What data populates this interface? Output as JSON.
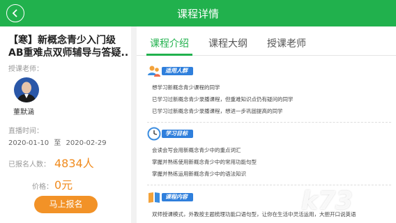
{
  "header": {
    "title": "课程详情"
  },
  "course": {
    "title_line1": "【寒】新概念青少入门级",
    "title_line2": "AB重难点双师辅导与答疑...",
    "teacher_label": "授课老师：",
    "teacher_name": "董默涵",
    "time_label": "直播时间：",
    "start_date": "2020-01-10",
    "date_sep": "至",
    "end_date": "2020-02-29",
    "enroll_label": "已报名人数：",
    "enroll_count": "4834人",
    "price_label": "价格：",
    "price": "0元",
    "apply_label": "马上报名"
  },
  "tabs": [
    {
      "label": "课程介绍",
      "active": true
    },
    {
      "label": "课程大纲",
      "active": false
    },
    {
      "label": "授课老师",
      "active": false
    }
  ],
  "sections": [
    {
      "badge": "适用人群",
      "icon": "people-icon",
      "items": [
        "想学习新概念青少课程的同学",
        "已学习过新概念青少录播课程，但重难知识点仍有疑问的同学",
        "已学习过新概念青少录播课程，想进一步巩固提高的同学"
      ]
    },
    {
      "badge": "学习目标",
      "icon": "clock-icon",
      "items": [
        "会读会写会用新概念青少中的重点词汇",
        "掌握并熟练使用新概念青少中的常用功能句型",
        "掌握并熟练运用新概念青少中的语法知识"
      ]
    },
    {
      "badge": "课程内容",
      "icon": "book-icon",
      "items": [
        "双师授课模式，外教按主题梳理功能口语句型，让你在生活中灵活运用，大胆开口说英语"
      ]
    }
  ],
  "colors": {
    "brand": "#21b14d",
    "accent": "#f29227",
    "badge": "#2f7fdc"
  },
  "watermark": "k73"
}
